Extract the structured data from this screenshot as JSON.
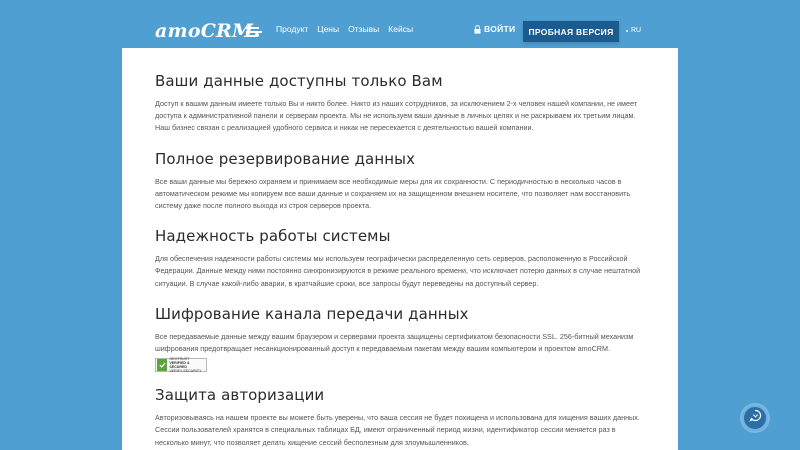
{
  "header": {
    "logo": "amoCRM",
    "nav": [
      "Продукт",
      "Цены",
      "Отзывы",
      "Кейсы"
    ],
    "login_label": "ВОЙТИ",
    "trial_label": "ПРОБНАЯ ВЕРСИЯ",
    "lang_label": "RU"
  },
  "sections": [
    {
      "title": "Ваши данные доступны только Вам",
      "text": "Доступ к вашим данным имеете только Вы и никто более. Никто из наших сотрудников, за исключением 2-х человек нашей компании, не имеет доступа к административной панели и серверам проекта. Мы не используем ваши данные в личных целях и не раскрываем их третьим лицам. Наш бизнес связан с реализацией удобного сервиса и никак не пересекается с деятельностью вашей компании."
    },
    {
      "title": "Полное резервирование данных",
      "text": "Все ваши данные мы бережно охраняем и принимаем все необходимые меры для их сохранности. С периодичностью в несколько часов в автоматическом режиме мы копируем все ваши данные и сохраняем их на защищенном внешнем носителе, что позволяет нам восстановить систему даже после полного выхода из строя серверов проекта."
    },
    {
      "title": "Надежность работы системы",
      "text": "Для обеспечения надежности работы системы мы используем географически распределенную сеть серверов, расположенную в Российской Федерации. Данные между ними постоянно синхронизируются в режиме реального времени, что исключает потерю данных в случае нештатной ситуации. В случае какой-либо аварии, в кратчайшие сроки, все запросы будут переведены на доступный сервер."
    },
    {
      "title": "Шифрование канала передачи данных",
      "text": "Все передаваемые данные между вашим браузером и серверами проекта защищены сертификатом безопасности SSL. 256-битный механизм шифрования предотвращает несанкционированный доступ к передаваемым пакетам между вашим компьютером и проектом amoCRM."
    },
    {
      "title": "Защита авторизации",
      "text": "Авторизовываясь на нашем проекте вы можете быть уверены, что ваша сессия не будет похищена и использована для хищения ваших данных. Сессии пользователей хранятся в специальных таблицах БД, имеют ограниченный период жизни, идентификатор сессии меняется раз в несколько минут, что позволяет делать хищение сессий бесполезным для злоумышленников."
    }
  ],
  "ssl_badge": {
    "line1": "GEOTRUST",
    "line2": "VERIFIED & SECURED",
    "line3": "VERIFY SECURITY"
  },
  "colors": {
    "background": "#4f9fd3",
    "trial_button": "#1c5b8e",
    "panel": "#ffffff",
    "badge_green": "#5ba33b"
  },
  "icons": [
    "menu-icon",
    "lock-icon",
    "chat-icon",
    "check-icon"
  ]
}
